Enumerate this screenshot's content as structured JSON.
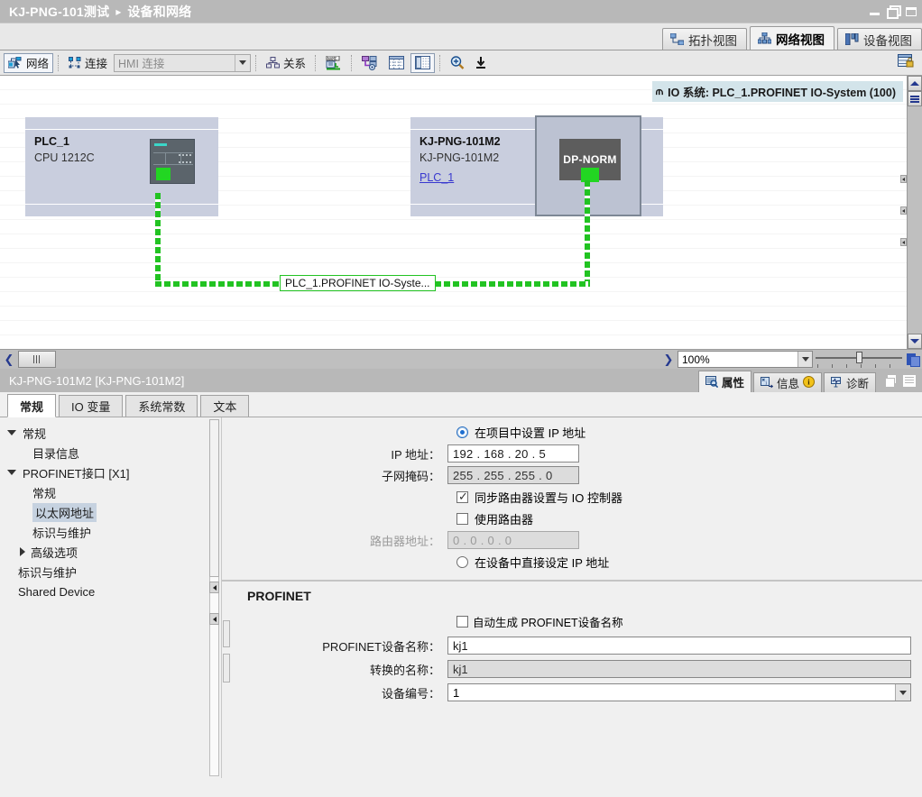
{
  "titlebar": {
    "project": "KJ-PNG-101测试",
    "separator": "▸",
    "page": "设备和网络",
    "minimize": "minimize",
    "restore": "restore",
    "close": "close"
  },
  "view_tabs": [
    {
      "label": "拓扑视图",
      "icon": "topology-icon",
      "active": false
    },
    {
      "label": "网络视图",
      "icon": "network-icon",
      "active": true
    },
    {
      "label": "设备视图",
      "icon": "device-icon",
      "active": false
    }
  ],
  "toolbar": {
    "network_label": "网络",
    "connection_label": "连接",
    "connection_combo_value": "HMI 连接",
    "relation_label": "关系",
    "icons": [
      "name-assign-icon",
      "address-overview-icon",
      "grid-icon",
      "page-layout-icon",
      "zoom-in-icon",
      "download-icon"
    ],
    "right_icon": "table-lock-icon"
  },
  "canvas": {
    "io_system_badge": "IO 系统: PLC_1.PROFINET IO-System (100)",
    "io_badge_pin": "pin-icon",
    "devices": [
      {
        "name": "PLC_1",
        "type": "CPU 1212C",
        "link": null,
        "module_label": null
      },
      {
        "name": "KJ-PNG-101M2",
        "type": "KJ-PNG-101M2",
        "link": "PLC_1",
        "module_label": "DP-NORM"
      }
    ],
    "network_line_label": "PLC_1.PROFINET IO-Syste...",
    "zoom_value": "100%"
  },
  "properties": {
    "header_title": "KJ-PNG-101M2 [KJ-PNG-101M2]",
    "tabs": [
      {
        "label": "属性",
        "icon": "properties-icon",
        "active": true,
        "badge": null
      },
      {
        "label": "信息",
        "icon": "info-icon",
        "active": false,
        "badge": "i"
      },
      {
        "label": "诊断",
        "icon": "diagnostics-icon",
        "active": false,
        "badge": null
      }
    ],
    "sheet_tabs": [
      {
        "label": "常规",
        "active": true
      },
      {
        "label": "IO 变量",
        "active": false
      },
      {
        "label": "系统常数",
        "active": false
      },
      {
        "label": "文本",
        "active": false
      }
    ],
    "nav": [
      {
        "label": "常规",
        "level": 1,
        "expander": "down",
        "selected": false
      },
      {
        "label": "目录信息",
        "level": 2,
        "expander": "none",
        "selected": false
      },
      {
        "label": "PROFINET接口 [X1]",
        "level": 1,
        "expander": "down",
        "selected": false
      },
      {
        "label": "常规",
        "level": 2,
        "expander": "none",
        "selected": false
      },
      {
        "label": "以太网地址",
        "level": 2,
        "expander": "none",
        "selected": true
      },
      {
        "label": "标识与维护",
        "level": 2,
        "expander": "none",
        "selected": false
      },
      {
        "label": "高级选项",
        "level": 2,
        "expander": "right",
        "selected": false
      },
      {
        "label": "标识与维护",
        "level": 1,
        "expander": "none",
        "selected": false
      },
      {
        "label": "Shared Device",
        "level": 1,
        "expander": "none",
        "selected": false
      }
    ],
    "ip_section": {
      "set_in_project_label": "在项目中设置 IP 地址",
      "set_in_project_checked": true,
      "ip_label": "IP 地址：",
      "ip_value": "192 . 168 . 20  . 5",
      "subnet_label": "子网掩码：",
      "subnet_value": "255 . 255 . 255 . 0",
      "sync_router_label": "同步路由器设置与 IO 控制器",
      "sync_router_checked": true,
      "use_router_label": "使用路由器",
      "use_router_checked": false,
      "router_label": "路由器地址：",
      "router_value": "0     . 0     . 0     . 0",
      "set_in_device_label": "在设备中直接设定 IP 地址",
      "set_in_device_checked": false
    },
    "profinet_section": {
      "title": "PROFINET",
      "auto_generate_label": "自动生成 PROFINET设备名称",
      "auto_generate_checked": false,
      "device_name_label": "PROFINET设备名称：",
      "device_name_value": "kj1",
      "converted_name_label": "转换的名称：",
      "converted_name_value": "kj1",
      "device_number_label": "设备编号：",
      "device_number_value": "1"
    },
    "header_icons": [
      "stack-icon",
      "lines-icon"
    ]
  },
  "colors": {
    "accent_blue": "#2f54b5",
    "link_blue": "#3838cf",
    "green": "#22c322",
    "titlebar": "#b8b8b8",
    "badge_bg": "#d3e4ea"
  }
}
